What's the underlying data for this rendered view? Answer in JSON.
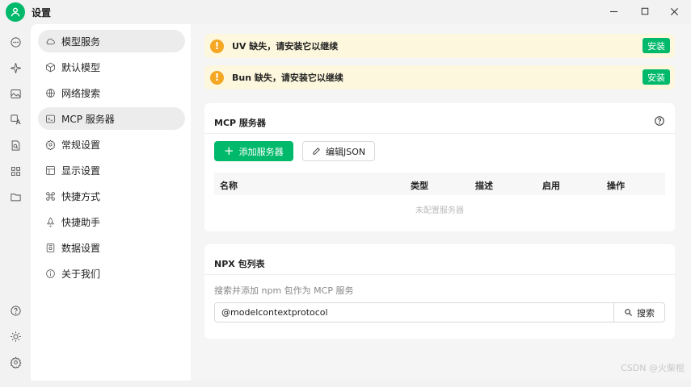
{
  "window": {
    "title": "设置"
  },
  "rail": {
    "top_icons": [
      "chat-icon",
      "sparkle-icon",
      "image-icon",
      "translate-icon",
      "search-doc-icon",
      "apps-icon",
      "folder-icon"
    ],
    "bottom_icons": [
      "help-icon",
      "theme-icon",
      "settings-icon"
    ]
  },
  "nav": {
    "items": [
      {
        "label": "模型服务",
        "icon": "cloud-icon",
        "active": true
      },
      {
        "label": "默认模型",
        "icon": "cube-icon"
      },
      {
        "label": "网络搜索",
        "icon": "globe-icon"
      },
      {
        "label": "MCP 服务器",
        "icon": "terminal-icon"
      },
      {
        "label": "常规设置",
        "icon": "gear-icon"
      },
      {
        "label": "显示设置",
        "icon": "layout-icon"
      },
      {
        "label": "快捷方式",
        "icon": "command-icon"
      },
      {
        "label": "快捷助手",
        "icon": "rocket-icon"
      },
      {
        "label": "数据设置",
        "icon": "storage-icon"
      },
      {
        "label": "关于我们",
        "icon": "info-icon"
      }
    ]
  },
  "notices": [
    {
      "text": "UV 缺失，请安装它以继续",
      "button": "安装"
    },
    {
      "text": "Bun 缺失，请安装它以继续",
      "button": "安装"
    }
  ],
  "mcp": {
    "title": "MCP 服务器",
    "add_button": "添加服务器",
    "edit_button": "编辑JSON",
    "columns": [
      "名称",
      "类型",
      "描述",
      "启用",
      "操作"
    ],
    "empty_text": "未配置服务器"
  },
  "npx": {
    "title": "NPX 包列表",
    "subtitle": "搜索并添加 npm 包作为 MCP 服务",
    "search_value": "@modelcontextprotocol",
    "search_button": "搜索"
  },
  "watermark": "CSDN @火柴棍",
  "colors": {
    "accent": "#00b96b",
    "warning": "#f5a623",
    "notice_bg": "#fdf7dd"
  }
}
